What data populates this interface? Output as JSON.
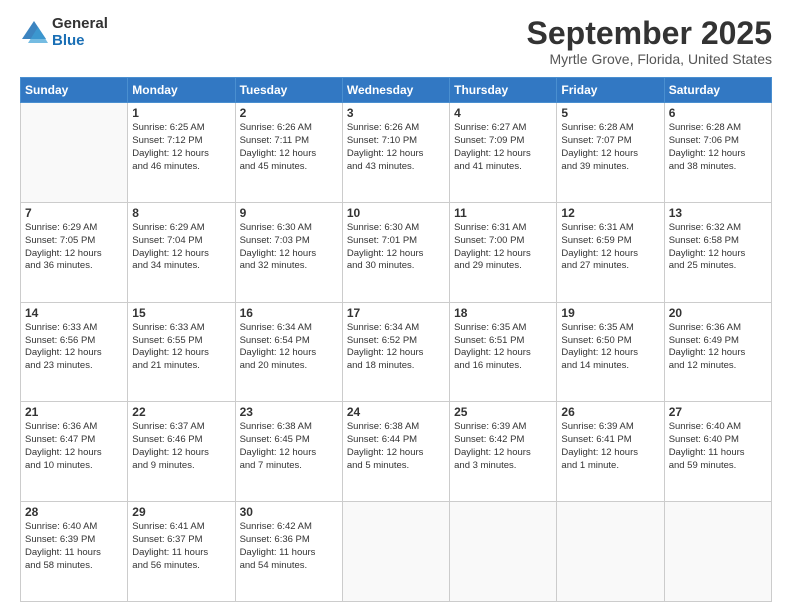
{
  "header": {
    "logo_line1": "General",
    "logo_line2": "Blue",
    "month": "September 2025",
    "location": "Myrtle Grove, Florida, United States"
  },
  "weekdays": [
    "Sunday",
    "Monday",
    "Tuesday",
    "Wednesday",
    "Thursday",
    "Friday",
    "Saturday"
  ],
  "weeks": [
    [
      {
        "num": "",
        "detail": ""
      },
      {
        "num": "1",
        "detail": "Sunrise: 6:25 AM\nSunset: 7:12 PM\nDaylight: 12 hours\nand 46 minutes."
      },
      {
        "num": "2",
        "detail": "Sunrise: 6:26 AM\nSunset: 7:11 PM\nDaylight: 12 hours\nand 45 minutes."
      },
      {
        "num": "3",
        "detail": "Sunrise: 6:26 AM\nSunset: 7:10 PM\nDaylight: 12 hours\nand 43 minutes."
      },
      {
        "num": "4",
        "detail": "Sunrise: 6:27 AM\nSunset: 7:09 PM\nDaylight: 12 hours\nand 41 minutes."
      },
      {
        "num": "5",
        "detail": "Sunrise: 6:28 AM\nSunset: 7:07 PM\nDaylight: 12 hours\nand 39 minutes."
      },
      {
        "num": "6",
        "detail": "Sunrise: 6:28 AM\nSunset: 7:06 PM\nDaylight: 12 hours\nand 38 minutes."
      }
    ],
    [
      {
        "num": "7",
        "detail": "Sunrise: 6:29 AM\nSunset: 7:05 PM\nDaylight: 12 hours\nand 36 minutes."
      },
      {
        "num": "8",
        "detail": "Sunrise: 6:29 AM\nSunset: 7:04 PM\nDaylight: 12 hours\nand 34 minutes."
      },
      {
        "num": "9",
        "detail": "Sunrise: 6:30 AM\nSunset: 7:03 PM\nDaylight: 12 hours\nand 32 minutes."
      },
      {
        "num": "10",
        "detail": "Sunrise: 6:30 AM\nSunset: 7:01 PM\nDaylight: 12 hours\nand 30 minutes."
      },
      {
        "num": "11",
        "detail": "Sunrise: 6:31 AM\nSunset: 7:00 PM\nDaylight: 12 hours\nand 29 minutes."
      },
      {
        "num": "12",
        "detail": "Sunrise: 6:31 AM\nSunset: 6:59 PM\nDaylight: 12 hours\nand 27 minutes."
      },
      {
        "num": "13",
        "detail": "Sunrise: 6:32 AM\nSunset: 6:58 PM\nDaylight: 12 hours\nand 25 minutes."
      }
    ],
    [
      {
        "num": "14",
        "detail": "Sunrise: 6:33 AM\nSunset: 6:56 PM\nDaylight: 12 hours\nand 23 minutes."
      },
      {
        "num": "15",
        "detail": "Sunrise: 6:33 AM\nSunset: 6:55 PM\nDaylight: 12 hours\nand 21 minutes."
      },
      {
        "num": "16",
        "detail": "Sunrise: 6:34 AM\nSunset: 6:54 PM\nDaylight: 12 hours\nand 20 minutes."
      },
      {
        "num": "17",
        "detail": "Sunrise: 6:34 AM\nSunset: 6:52 PM\nDaylight: 12 hours\nand 18 minutes."
      },
      {
        "num": "18",
        "detail": "Sunrise: 6:35 AM\nSunset: 6:51 PM\nDaylight: 12 hours\nand 16 minutes."
      },
      {
        "num": "19",
        "detail": "Sunrise: 6:35 AM\nSunset: 6:50 PM\nDaylight: 12 hours\nand 14 minutes."
      },
      {
        "num": "20",
        "detail": "Sunrise: 6:36 AM\nSunset: 6:49 PM\nDaylight: 12 hours\nand 12 minutes."
      }
    ],
    [
      {
        "num": "21",
        "detail": "Sunrise: 6:36 AM\nSunset: 6:47 PM\nDaylight: 12 hours\nand 10 minutes."
      },
      {
        "num": "22",
        "detail": "Sunrise: 6:37 AM\nSunset: 6:46 PM\nDaylight: 12 hours\nand 9 minutes."
      },
      {
        "num": "23",
        "detail": "Sunrise: 6:38 AM\nSunset: 6:45 PM\nDaylight: 12 hours\nand 7 minutes."
      },
      {
        "num": "24",
        "detail": "Sunrise: 6:38 AM\nSunset: 6:44 PM\nDaylight: 12 hours\nand 5 minutes."
      },
      {
        "num": "25",
        "detail": "Sunrise: 6:39 AM\nSunset: 6:42 PM\nDaylight: 12 hours\nand 3 minutes."
      },
      {
        "num": "26",
        "detail": "Sunrise: 6:39 AM\nSunset: 6:41 PM\nDaylight: 12 hours\nand 1 minute."
      },
      {
        "num": "27",
        "detail": "Sunrise: 6:40 AM\nSunset: 6:40 PM\nDaylight: 11 hours\nand 59 minutes."
      }
    ],
    [
      {
        "num": "28",
        "detail": "Sunrise: 6:40 AM\nSunset: 6:39 PM\nDaylight: 11 hours\nand 58 minutes."
      },
      {
        "num": "29",
        "detail": "Sunrise: 6:41 AM\nSunset: 6:37 PM\nDaylight: 11 hours\nand 56 minutes."
      },
      {
        "num": "30",
        "detail": "Sunrise: 6:42 AM\nSunset: 6:36 PM\nDaylight: 11 hours\nand 54 minutes."
      },
      {
        "num": "",
        "detail": ""
      },
      {
        "num": "",
        "detail": ""
      },
      {
        "num": "",
        "detail": ""
      },
      {
        "num": "",
        "detail": ""
      }
    ]
  ]
}
